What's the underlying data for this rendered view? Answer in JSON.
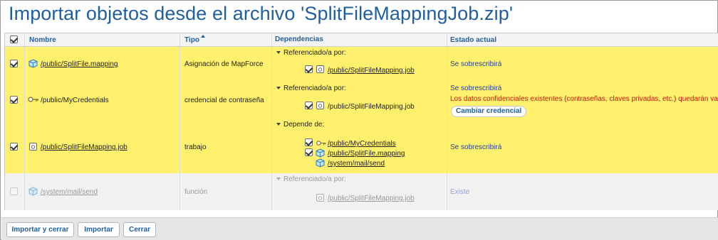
{
  "title": "Importar objetos desde el archivo 'SplitFileMappingJob.zip'",
  "columns": {
    "name": "Nombre",
    "type": "Tipo",
    "dependencies": "Dependencias",
    "status": "Estado actual"
  },
  "rows": [
    {
      "checked": true,
      "name": "/public/SplitFile.mapping",
      "icon": "mapping-icon",
      "type": "Asignación de MapForce",
      "dep_header": "Referenciado/a por:",
      "deps": [
        "/public/SplitFileMapping.job"
      ],
      "status": "Se sobrescribirá"
    },
    {
      "checked": true,
      "name": "/public/MyCredentials",
      "icon": "key-icon",
      "type": "credencial de contraseña",
      "dep_header": "Referenciado/a por:",
      "deps": [
        "/public/SplitFileMapping.job"
      ],
      "status": "Se sobrescribirá",
      "warning": "Los datos confidenciales existentes (contraseñas, claves privadas, etc.) quedarán vacíos",
      "action": "Cambiar credencial"
    },
    {
      "checked": true,
      "name": "/public/SplitFileMapping.job",
      "icon": "job-icon",
      "type": "trabajo",
      "dep_header": "Depende de:",
      "deps": [
        "/public/MyCredentials",
        "/public/SplitFile.mapping",
        "/system/mail/send"
      ],
      "status": "Se sobrescribirá"
    },
    {
      "checked": false,
      "name": "/system/mail/send",
      "icon": "mapping-icon",
      "type": "función",
      "dep_header": "Referenciado/a por:",
      "deps": [
        "/public/SplitFileMapping.job"
      ],
      "status": "Existe"
    }
  ],
  "buttons": {
    "import_close": "Importar y cerrar",
    "import": "Importar",
    "close": "Cerrar"
  },
  "colors": {
    "accent": "#1f5fa0",
    "selected_row": "#fff06e",
    "warning": "#d01010"
  }
}
